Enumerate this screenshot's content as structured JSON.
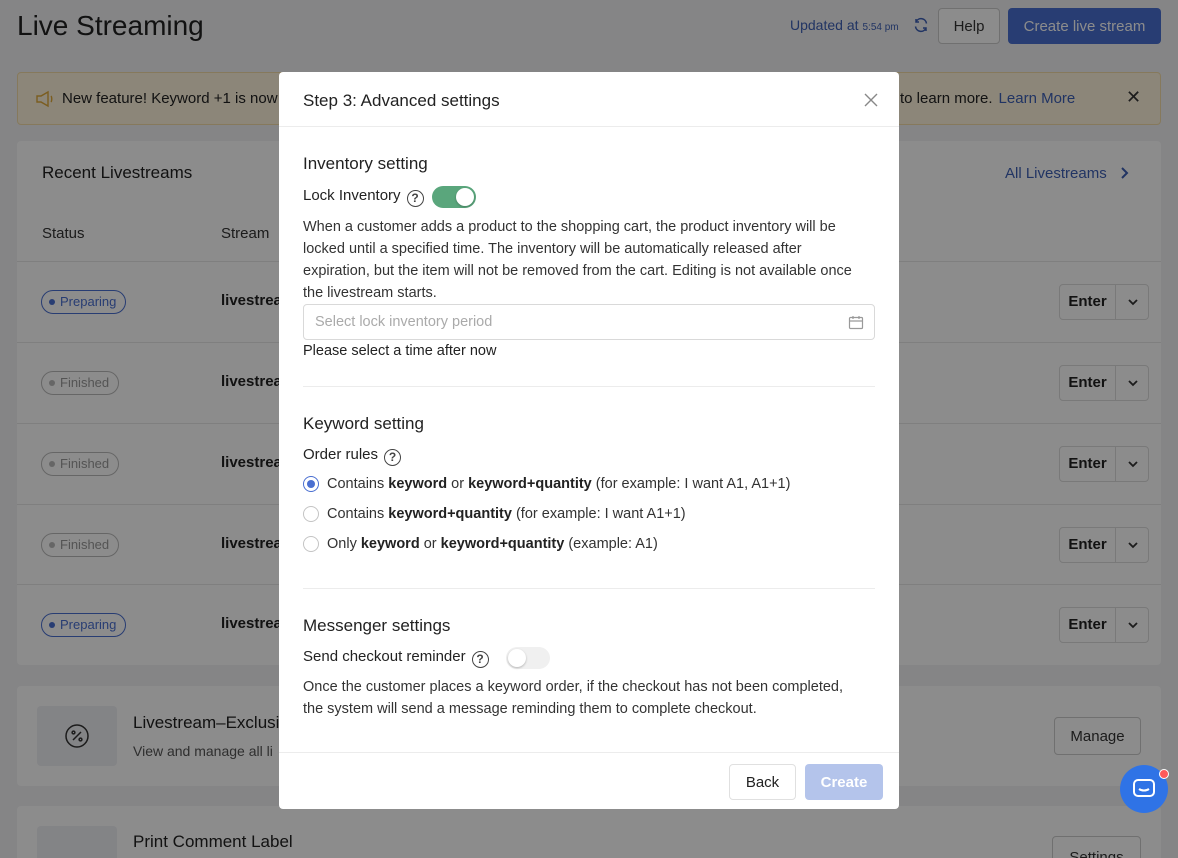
{
  "header": {
    "title": "Live Streaming",
    "updated_label": "Updated at",
    "updated_time": "5:54 pm",
    "help_label": "Help",
    "create_label": "Create live stream"
  },
  "banner": {
    "text_left": "New feature! Keyword +1 is now",
    "text_right": "to learn more.",
    "link": "Learn More",
    "close": "✕"
  },
  "recent": {
    "title": "Recent Livestreams",
    "all_link": "All Livestreams",
    "columns": {
      "status": "Status",
      "stream": "Stream"
    },
    "rows": [
      {
        "status": "Preparing",
        "name": "livestrea",
        "action": "Enter"
      },
      {
        "status": "Finished",
        "name": "livestrea",
        "action": "Enter"
      },
      {
        "status": "Finished",
        "name": "livestrea",
        "action": "Enter"
      },
      {
        "status": "Finished",
        "name": "livestrea",
        "action": "Enter"
      },
      {
        "status": "Preparing",
        "name": "livestrea",
        "action": "Enter"
      }
    ]
  },
  "exclusive": {
    "title": "Livestream–Exclusi",
    "subtitle": "View and manage all li",
    "button": "Manage"
  },
  "print": {
    "title": "Print Comment Label",
    "button": "Settings"
  },
  "modal": {
    "title": "Step 3: Advanced settings",
    "inventory": {
      "section": "Inventory setting",
      "lock_label": "Lock Inventory",
      "lock_on": true,
      "description": "When a customer adds a product to the shopping cart, the product inventory will be locked until a specified time. The inventory will be automatically released after expiration, but the item will not be removed from the cart. Editing is not available once the livestream starts.",
      "period_placeholder": "Select lock inventory period",
      "hint": "Please select a time after now"
    },
    "keyword": {
      "section": "Keyword setting",
      "order_rules_label": "Order rules",
      "options": [
        {
          "prefix": "Contains ",
          "b1": "keyword",
          "mid": " or ",
          "b2": "keyword+quantity",
          "suffix": " (for example: I want A1, A1+1)",
          "checked": true
        },
        {
          "prefix": "Contains ",
          "b1": "keyword+quantity",
          "mid": "",
          "b2": "",
          "suffix": " (for example: I want A1+1)",
          "checked": false
        },
        {
          "prefix": "Only ",
          "b1": "keyword",
          "mid": " or ",
          "b2": "keyword+quantity",
          "suffix": " (example: A1)",
          "checked": false
        }
      ]
    },
    "messenger": {
      "section": "Messenger settings",
      "reminder_label": "Send checkout reminder",
      "reminder_on": false,
      "description": "Once the customer places a keyword order, if the checkout has not been completed, the system will send a message reminding them to complete checkout."
    },
    "footer": {
      "back": "Back",
      "create": "Create"
    }
  },
  "colors": {
    "accent": "#4a6fd1",
    "toggle_on": "#5aa67c",
    "chat": "#2f73e6"
  }
}
